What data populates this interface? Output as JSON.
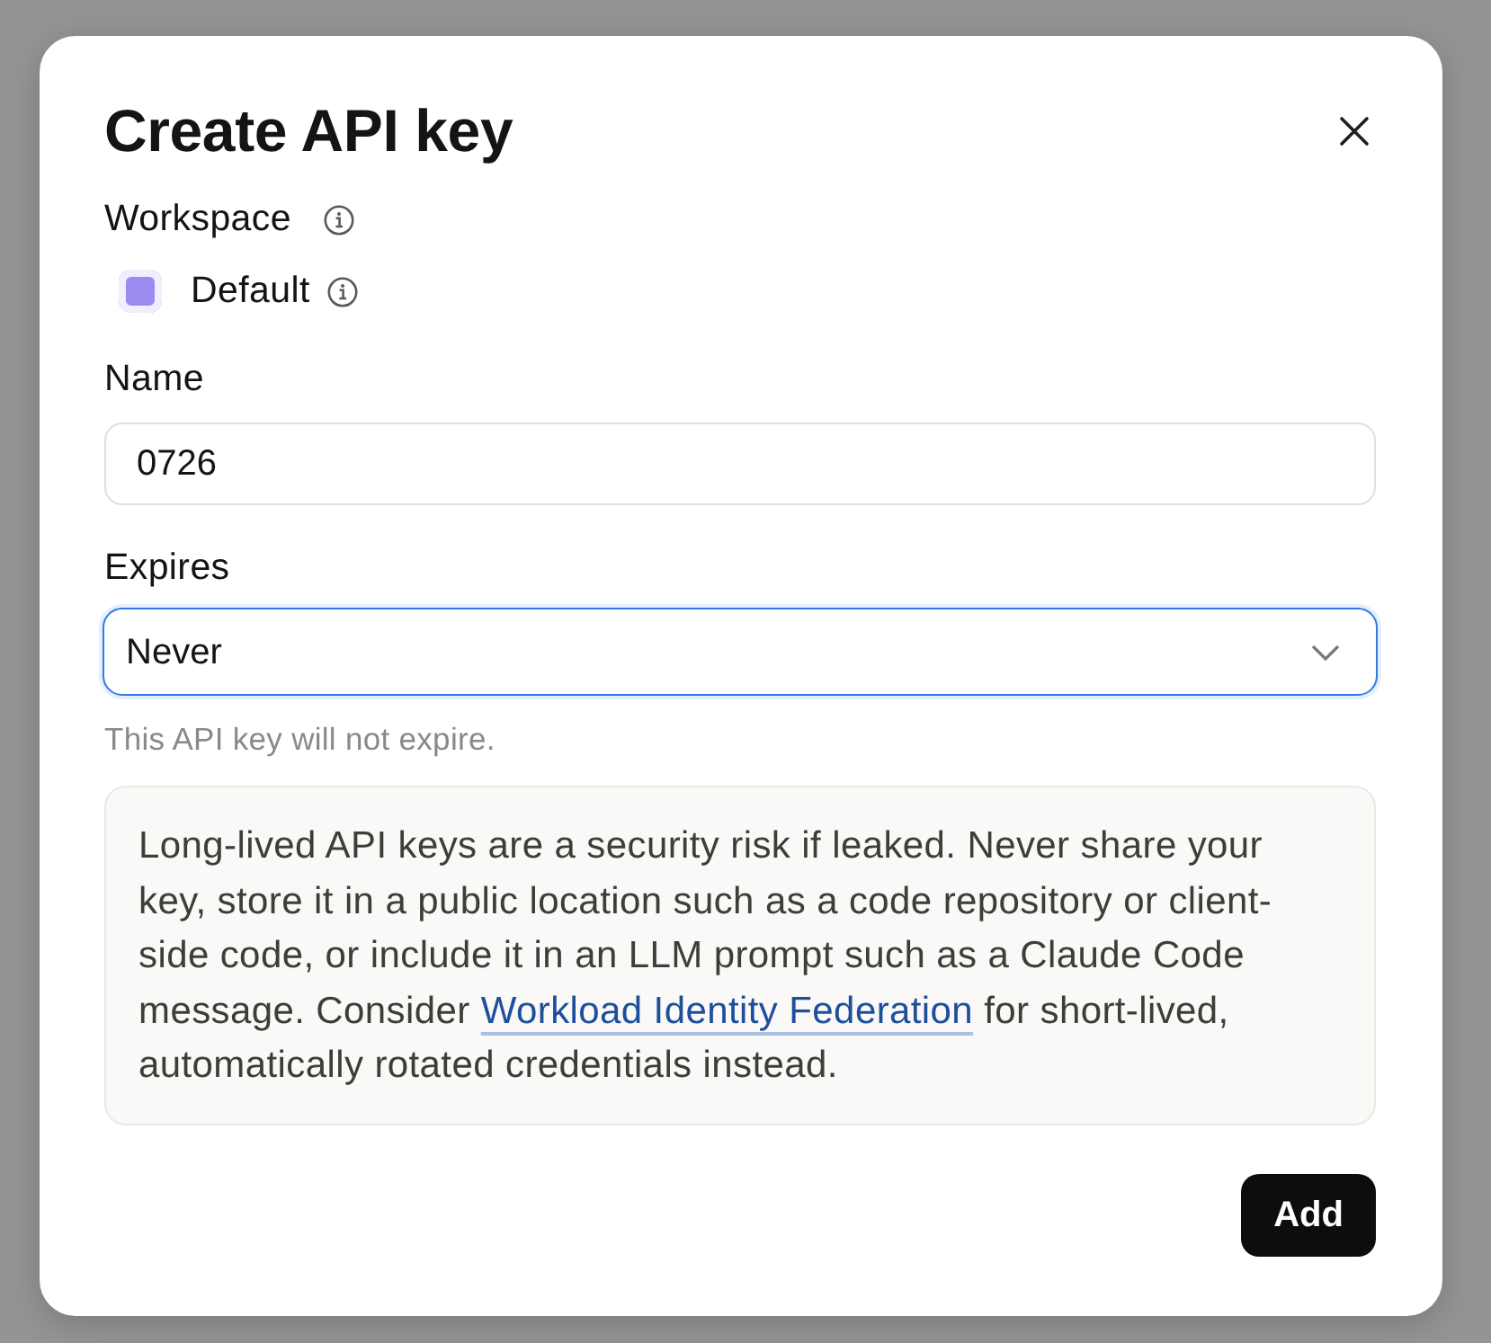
{
  "dialog": {
    "title": "Create API key"
  },
  "workspace": {
    "label": "Workspace",
    "value": "Default"
  },
  "name_field": {
    "label": "Name",
    "value": "0726"
  },
  "expires_field": {
    "label": "Expires",
    "value": "Never",
    "focused": true,
    "hint": "This API key will not expire."
  },
  "notice": {
    "text_before": "Long-lived API keys are a security risk if leaked. Never share your key, store it in a public location such as a code repository or client-side code, or include it in an LLM prompt such as a Claude Code message. Consider ",
    "link": "Workload Identity Federation",
    "text_after": " for short-lived, automatically rotated credentials instead."
  },
  "buttons": [
    {
      "label": "Add",
      "kind": "primary"
    }
  ]
}
